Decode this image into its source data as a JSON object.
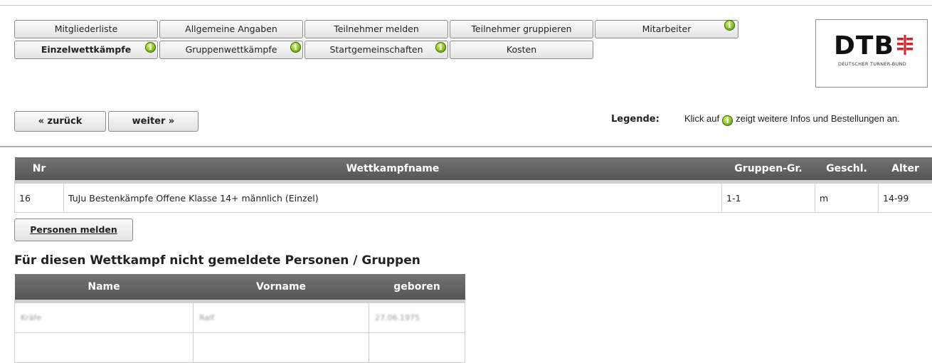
{
  "tabs_row1": [
    {
      "label": "Mitgliederliste",
      "info": false,
      "bold": false
    },
    {
      "label": "Allgemeine Angaben",
      "info": false,
      "bold": false
    },
    {
      "label": "Teilnehmer melden",
      "info": false,
      "bold": false
    },
    {
      "label": "Teilnehmer gruppieren",
      "info": false,
      "bold": false
    },
    {
      "label": "Mitarbeiter",
      "info": true,
      "bold": false
    }
  ],
  "tabs_row2": [
    {
      "label": "Einzelwettkämpfe",
      "info": true,
      "bold": true
    },
    {
      "label": "Gruppenwettkämpfe",
      "info": true,
      "bold": false
    },
    {
      "label": "Startgemeinschaften",
      "info": true,
      "bold": false
    },
    {
      "label": "Kosten",
      "info": false,
      "bold": false
    }
  ],
  "nav": {
    "back": "« zurück",
    "next": "weiter »"
  },
  "legend": {
    "label": "Legende:",
    "text_before": "Klick auf",
    "text_after": "zeigt weitere Infos und Bestellungen an."
  },
  "logo": {
    "main": "DTB",
    "sub": "DEUTSCHER TURNER-BUND"
  },
  "info_icon_glyph": "i",
  "wettkampf_table": {
    "headers": [
      "Nr",
      "Wettkampfname",
      "Gruppen-Gr.",
      "Geschl.",
      "Alter"
    ],
    "rows": [
      [
        "16",
        "TuJu Bestenkämpfe Offene Klasse 14+ männlich (Einzel)",
        "1-1",
        "m",
        "14-99"
      ]
    ]
  },
  "personen_button": "Personen melden",
  "not_registered_title": "Für diesen Wettkampf nicht gemeldete Personen / Gruppen",
  "personen_table": {
    "headers": [
      "Name",
      "Vorname",
      "geboren"
    ],
    "rows": [
      [
        "Kräfe",
        "Ralf",
        "27.06.1975"
      ],
      [
        "",
        "",
        ""
      ]
    ]
  },
  "colors": {
    "header_bg": "#5f5f5f",
    "info_green": "#7db51a",
    "logo_red": "#d2232a"
  }
}
